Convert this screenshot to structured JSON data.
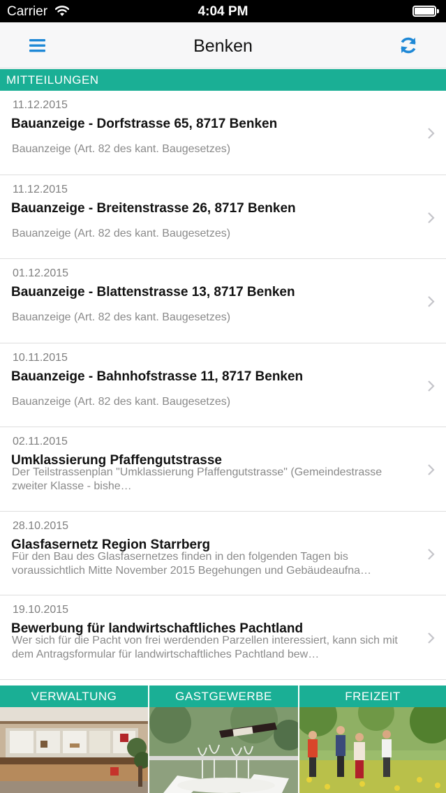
{
  "status_bar": {
    "carrier": "Carrier",
    "time": "4:04 PM"
  },
  "nav": {
    "title": "Benken",
    "menu_icon": "hamburger-menu-icon",
    "refresh_icon": "refresh-icon",
    "accent": "#1e88d6"
  },
  "section": {
    "title": "MITTEILUNGEN",
    "color": "#1aaf95"
  },
  "items": [
    {
      "date": "11.12.2015",
      "title": "Bauanzeige - Dorfstrasse 65, 8717 Benken",
      "desc": "Bauanzeige (Art. 82 des kant. Baugesetzes)"
    },
    {
      "date": "11.12.2015",
      "title": "Bauanzeige - Breitenstrasse 26, 8717 Benken",
      "desc": "Bauanzeige (Art. 82 des kant. Baugesetzes)"
    },
    {
      "date": "01.12.2015",
      "title": "Bauanzeige - Blattenstrasse 13, 8717 Benken",
      "desc": "Bauanzeige (Art. 82 des kant. Baugesetzes)"
    },
    {
      "date": "10.11.2015",
      "title": "Bauanzeige - Bahnhofstrasse 11, 8717 Benken",
      "desc": "Bauanzeige (Art. 82 des kant. Baugesetzes)"
    },
    {
      "date": "02.11.2015",
      "title": "Umklassierung Pfaffengutstrasse",
      "desc": "Der Teilstrassenplan \"Umklassierung Pfaffengutstrasse\" (Gemeindestrasse zweiter Klasse - bishe…"
    },
    {
      "date": "28.10.2015",
      "title": "Glasfasernetz Region Starrberg",
      "desc": "Für den Bau des Glasfasernetzes finden in den folgenden Tagen bis voraussichtlich Mitte November 2015 Begehungen und Gebäudeaufna…"
    },
    {
      "date": "19.10.2015",
      "title": "Bewerbung für landwirtschaftliches Pachtland",
      "desc": "Wer sich für die Pacht von frei werdenden Parzellen interessiert, kann sich mit dem Antragsformular für landwirtschaftliches Pachtland bew…"
    }
  ],
  "tabs": [
    {
      "label": "VERWALTUNG"
    },
    {
      "label": "GASTGEWERBE"
    },
    {
      "label": "FREIZEIT"
    }
  ]
}
